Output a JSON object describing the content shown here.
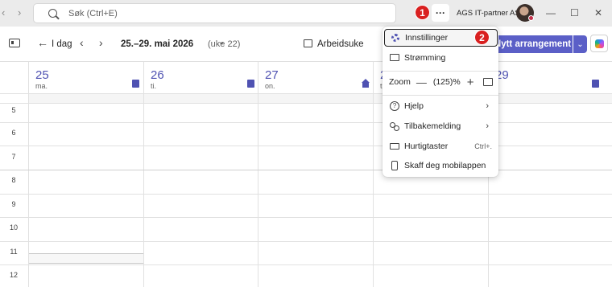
{
  "titlebar": {
    "back": "‹",
    "forward": "›",
    "search_placeholder": "Søk (Ctrl+E)",
    "more_label": "···",
    "org_name": "AGS IT-partner AS",
    "minimize": "—",
    "maximize": "☐",
    "close": "✕"
  },
  "callouts": {
    "one": "1",
    "two": "2"
  },
  "toolbar": {
    "today_label": "I dag",
    "date_range": "25.–29. mai 2026",
    "week_label": "(uke 22)",
    "view_label": "Arbeidsuke",
    "new_event_label": "Nytt arrangement"
  },
  "days": [
    {
      "num": "25",
      "name": "ma."
    },
    {
      "num": "26",
      "name": "ti."
    },
    {
      "num": "27",
      "name": "on."
    },
    {
      "num": "2",
      "name": "t"
    },
    {
      "num": "29",
      "name": ""
    }
  ],
  "hours": [
    "5",
    "6",
    "7",
    "8",
    "9",
    "10",
    "11",
    "12"
  ],
  "menu": {
    "settings": "Innstillinger",
    "streaming": "Strømming",
    "zoom_label": "Zoom",
    "zoom_minus": "—",
    "zoom_value": "(125)%",
    "zoom_plus": "+",
    "help": "Hjelp",
    "feedback": "Tilbakemelding",
    "shortcuts": "Hurtigtaster",
    "shortcuts_key": "Ctrl+.",
    "mobile": "Skaff deg mobilappen"
  },
  "colors": {
    "accent": "#5b5fc7",
    "badge": "#d92020"
  }
}
